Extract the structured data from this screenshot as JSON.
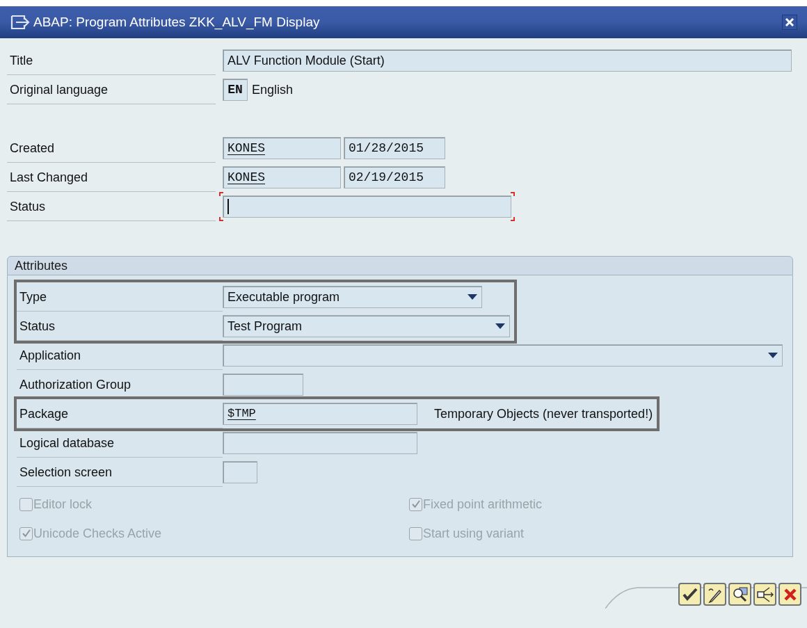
{
  "window": {
    "title": "ABAP: Program Attributes ZKK_ALV_FM Display"
  },
  "general": [
    {
      "label": "Title",
      "kind": "text",
      "value": "ALV Function Module (Start)"
    },
    {
      "label": "Original language",
      "kind": "language",
      "code": "EN",
      "text": "English"
    },
    {
      "label": "Created",
      "kind": "user_date",
      "user": "KONES",
      "date": "01/28/2015"
    },
    {
      "label": "Last Changed",
      "kind": "user_date",
      "user": "KONES",
      "date": "02/19/2015"
    },
    {
      "label": "Status",
      "kind": "text",
      "focused": true
    }
  ],
  "attributes": {
    "title": "Attributes",
    "rows": [
      {
        "label": "Type",
        "kind": "dropdown",
        "value": "Executable program",
        "highlighted": true
      },
      {
        "label": "Status",
        "kind": "dropdown",
        "value": "Test Program",
        "highlighted": true
      },
      {
        "label": "Application",
        "kind": "dropdown",
        "highlighted": false
      },
      {
        "label": "Authorization Group",
        "kind": "text",
        "highlighted": false
      },
      {
        "label": "Package",
        "kind": "package",
        "value": "$TMP",
        "description": "Temporary Objects (never transported!)",
        "highlighted": true
      },
      {
        "label": "Logical database",
        "kind": "text",
        "highlighted": false
      },
      {
        "label": "Selection screen",
        "kind": "text",
        "highlighted": false
      }
    ],
    "checkboxes": [
      {
        "label": "Editor lock",
        "checked": false,
        "disabled": true
      },
      {
        "label": "Fixed point arithmetic",
        "checked": true,
        "disabled": true
      },
      {
        "label": "Unicode Checks Active",
        "checked": true,
        "disabled": true
      },
      {
        "label": "Start using variant",
        "checked": false,
        "disabled": true
      }
    ]
  },
  "toolbar": [
    {
      "kind": "check"
    },
    {
      "kind": "pencil"
    },
    {
      "kind": "magnifier"
    },
    {
      "kind": "export"
    },
    {
      "kind": "cancel"
    }
  ]
}
